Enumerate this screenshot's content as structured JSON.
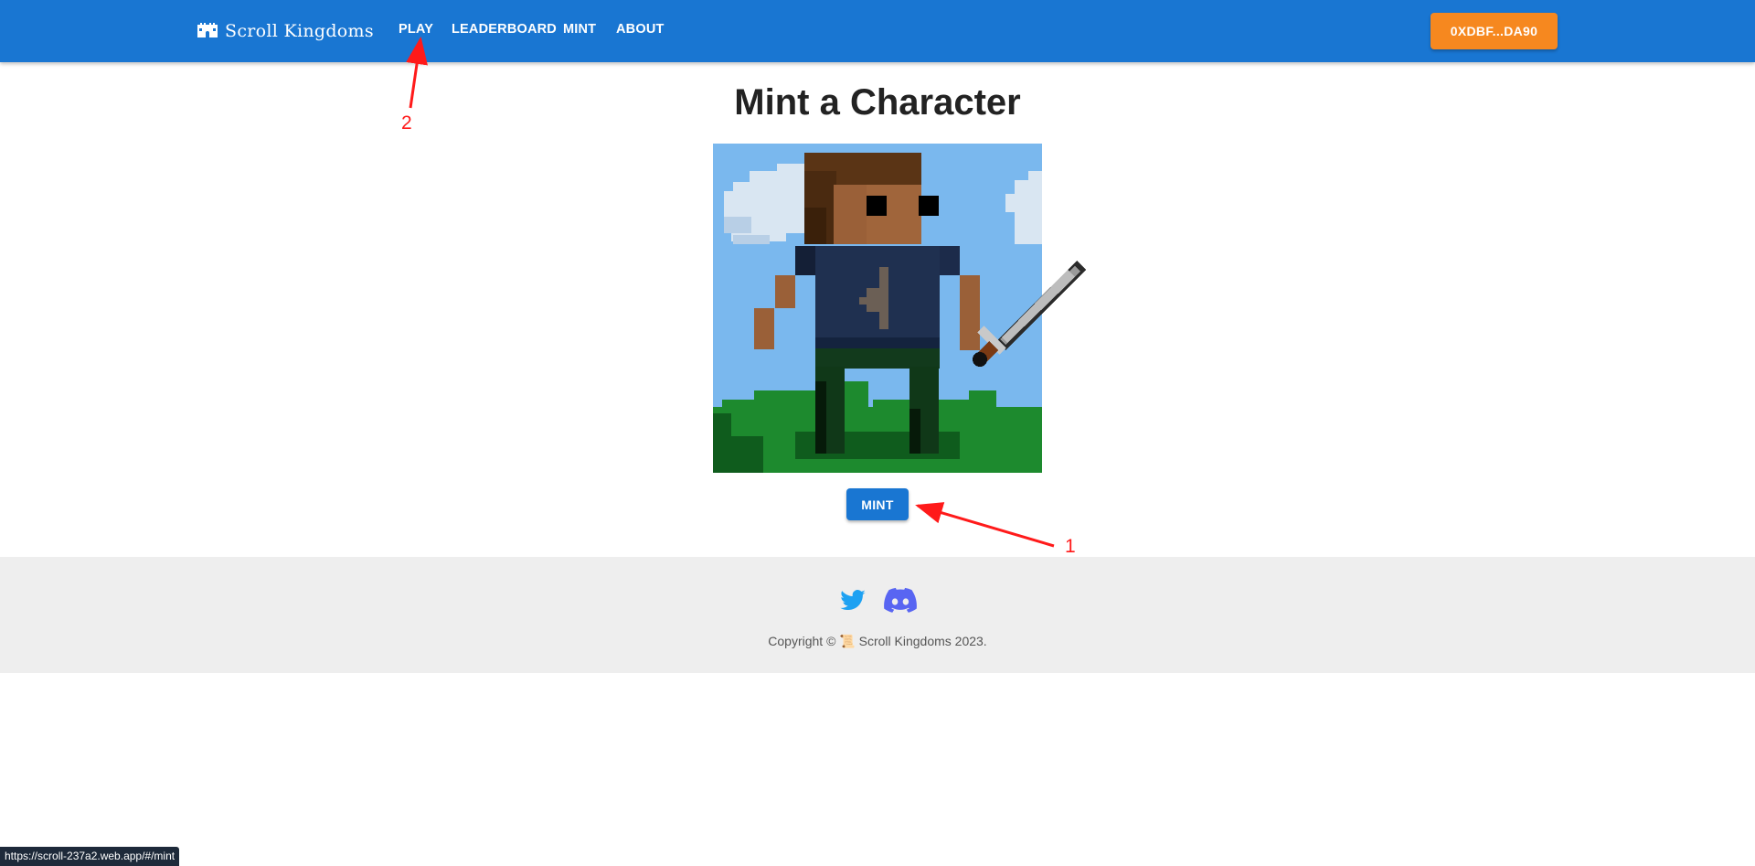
{
  "header": {
    "brand": "Scroll Kingdoms",
    "brand_icon": "castle-icon",
    "nav": [
      "PLAY",
      "LEADERBOARD",
      "MINT",
      "ABOUT"
    ],
    "wallet_label": "0XDBF...DA90"
  },
  "main": {
    "title": "Mint a Character",
    "mint_label": "MINT"
  },
  "annotations": {
    "one": "1",
    "two": "2"
  },
  "footer": {
    "social": [
      "twitter-icon",
      "discord-icon"
    ],
    "copyright": "Copyright © 📜 Scroll Kingdoms 2023."
  },
  "statusbar": {
    "url": "https://scroll-237a2.web.app/#/mint"
  },
  "colors": {
    "primary": "#1976d2",
    "accent": "#f6881f",
    "annotation": "#ff1a1a",
    "footer_bg": "#eeeeee"
  }
}
